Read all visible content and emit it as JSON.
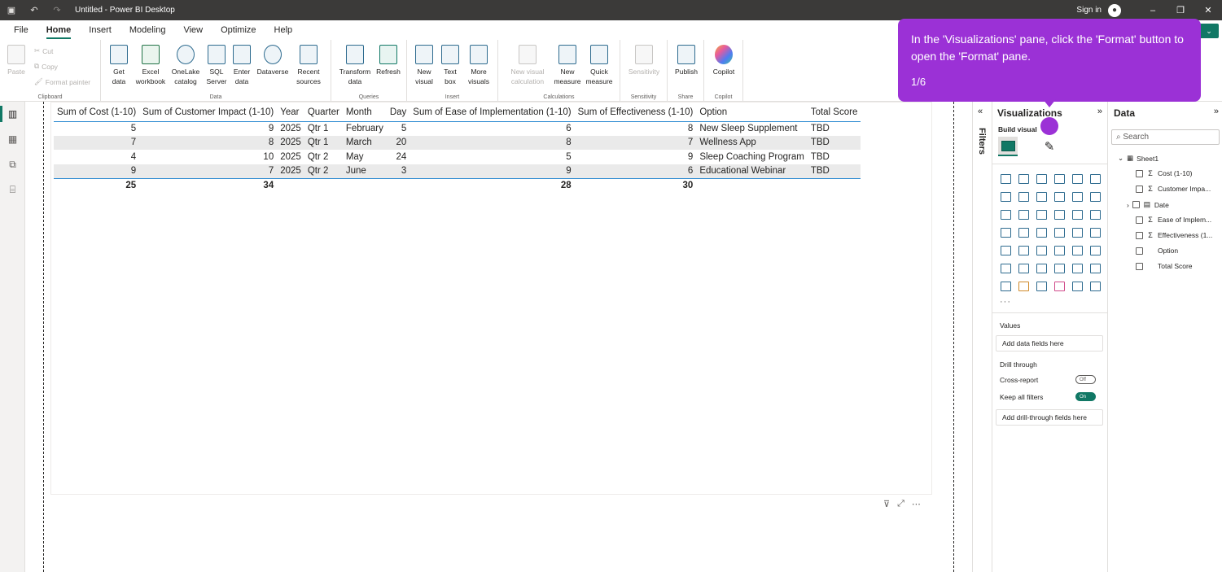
{
  "window": {
    "title": "Untitled - Power BI Desktop",
    "sign_in": "Sign in",
    "minimize": "–",
    "restore": "❐",
    "close": "✕"
  },
  "menu": {
    "tabs": [
      "File",
      "Home",
      "Insert",
      "Modeling",
      "View",
      "Optimize",
      "Help"
    ],
    "active": "Home"
  },
  "ribbon": {
    "clipboard": {
      "paste": "Paste",
      "cut": "Cut",
      "copy": "Copy",
      "format_painter": "Format painter",
      "label": "Clipboard"
    },
    "data": {
      "get_data": [
        "Get",
        "data"
      ],
      "excel": [
        "Excel",
        "workbook"
      ],
      "onelake": [
        "OneLake",
        "catalog"
      ],
      "sql": [
        "SQL",
        "Server"
      ],
      "enter": [
        "Enter",
        "data"
      ],
      "dataverse": "Dataverse",
      "recent": [
        "Recent",
        "sources"
      ],
      "label": "Data"
    },
    "queries": {
      "transform": [
        "Transform",
        "data"
      ],
      "refresh": "Refresh",
      "label": "Queries"
    },
    "insert": {
      "new_visual": [
        "New",
        "visual"
      ],
      "text_box": [
        "Text",
        "box"
      ],
      "more_visuals": [
        "More",
        "visuals"
      ],
      "label": "Insert"
    },
    "calculations": {
      "new_visual_calc": [
        "New visual",
        "calculation"
      ],
      "new_measure": [
        "New",
        "measure"
      ],
      "quick_measure": [
        "Quick",
        "measure"
      ],
      "label": "Calculations"
    },
    "sensitivity": {
      "btn": "Sensitivity",
      "label": "Sensitivity"
    },
    "share": {
      "publish": "Publish",
      "label": "Share"
    },
    "copilot": {
      "btn": "Copilot",
      "label": "Copilot"
    }
  },
  "table": {
    "headers": [
      "Sum of Cost (1-10)",
      "Sum of Customer Impact (1-10)",
      "Year",
      "Quarter",
      "Month",
      "Day",
      "Sum of Ease of Implementation (1-10)",
      "Sum of Effectiveness (1-10)",
      "Option",
      "Total Score"
    ],
    "rows": [
      [
        "5",
        "9",
        "2025",
        "Qtr 1",
        "February",
        "5",
        "6",
        "8",
        "New Sleep Supplement",
        "TBD"
      ],
      [
        "7",
        "8",
        "2025",
        "Qtr 1",
        "March",
        "20",
        "8",
        "7",
        "Wellness App",
        "TBD"
      ],
      [
        "4",
        "10",
        "2025",
        "Qtr 2",
        "May",
        "24",
        "5",
        "9",
        "Sleep Coaching Program",
        "TBD"
      ],
      [
        "9",
        "7",
        "2025",
        "Qtr 2",
        "June",
        "3",
        "9",
        "6",
        "Educational Webinar",
        "TBD"
      ]
    ],
    "totals": [
      "25",
      "34",
      "",
      "",
      "",
      "",
      "28",
      "30",
      "",
      ""
    ]
  },
  "filters": {
    "label": "Filters"
  },
  "visualizations": {
    "title": "Visualizations",
    "build_label": "Build visual",
    "more": "···",
    "values_label": "Values",
    "values_placeholder": "Add data fields here",
    "drill_label": "Drill through",
    "cross_report": "Cross-report",
    "cross_report_state": "Off",
    "keep_filters": "Keep all filters",
    "keep_filters_state": "On",
    "drill_placeholder": "Add drill-through fields here"
  },
  "data_pane": {
    "title": "Data",
    "search_placeholder": "Search",
    "table_name": "Sheet1",
    "fields": [
      {
        "name": "Cost (1-10)",
        "sigma": true
      },
      {
        "name": "Customer Impa...",
        "sigma": true
      },
      {
        "name": "Date",
        "sigma": false,
        "expandable": true
      },
      {
        "name": "Ease of Implem...",
        "sigma": true
      },
      {
        "name": "Effectiveness (1...",
        "sigma": true
      },
      {
        "name": "Option",
        "sigma": false
      },
      {
        "name": "Total Score",
        "sigma": false
      }
    ]
  },
  "tooltip": {
    "message": "In the 'Visualizations' pane, click the 'Format' button to open the 'Format' pane.",
    "step": "1/6"
  },
  "colors": {
    "accent": "#117865",
    "tooltip": "#9b31d6",
    "titlebar": "#3b3a39",
    "table_line": "#2b8ad1"
  }
}
